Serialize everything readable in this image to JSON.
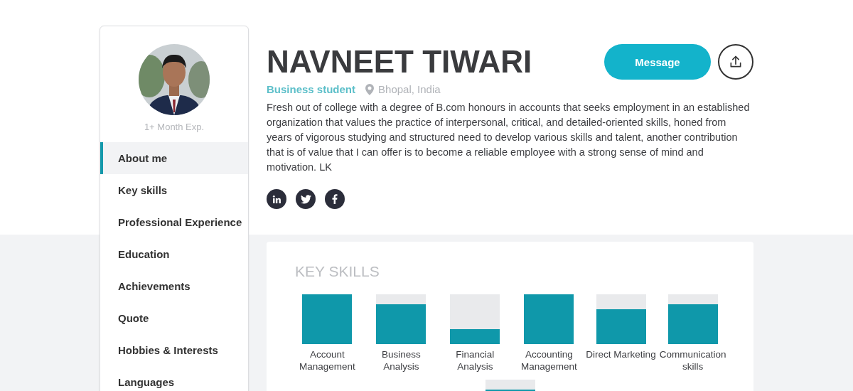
{
  "profile": {
    "name": "NAVNEET TIWARI",
    "role": "Business student",
    "location": "Bhopal, India",
    "experience": "1+ Month Exp.",
    "about": "Fresh out of college with a degree of B.com honours in accounts that seeks employment in an established organization that values the practice of interpersonal, critical, and detailed-oriented skills, honed from years of vigorous studying and structured need to develop various skills and talent, another contribution that is of value that I can offer is to become a reliable employee with a strong sense of mind and motivation. LK"
  },
  "actions": {
    "message": "Message"
  },
  "social": [
    {
      "kind": "linkedin"
    },
    {
      "kind": "twitter"
    },
    {
      "kind": "facebook"
    }
  ],
  "sidebar": {
    "items": [
      {
        "label": "About me",
        "selected": true
      },
      {
        "label": "Key skills",
        "selected": false
      },
      {
        "label": "Professional Experience",
        "selected": false
      },
      {
        "label": "Education",
        "selected": false
      },
      {
        "label": "Achievements",
        "selected": false
      },
      {
        "label": "Quote",
        "selected": false
      },
      {
        "label": "Hobbies & Interests",
        "selected": false
      },
      {
        "label": "Languages",
        "selected": false
      }
    ]
  },
  "key_skills": {
    "title": "KEY SKILLS",
    "skills": [
      {
        "name": "Account Management",
        "kind": "full"
      },
      {
        "name": "Business Analysis",
        "kind": "high"
      },
      {
        "name": "Financial Analysis",
        "kind": "low"
      },
      {
        "name": "Accounting Management",
        "kind": "full"
      },
      {
        "name": "Direct Marketing",
        "kind": "mid"
      },
      {
        "name": "Communication skills",
        "kind": "high"
      },
      {
        "kind": "high"
      }
    ]
  }
}
